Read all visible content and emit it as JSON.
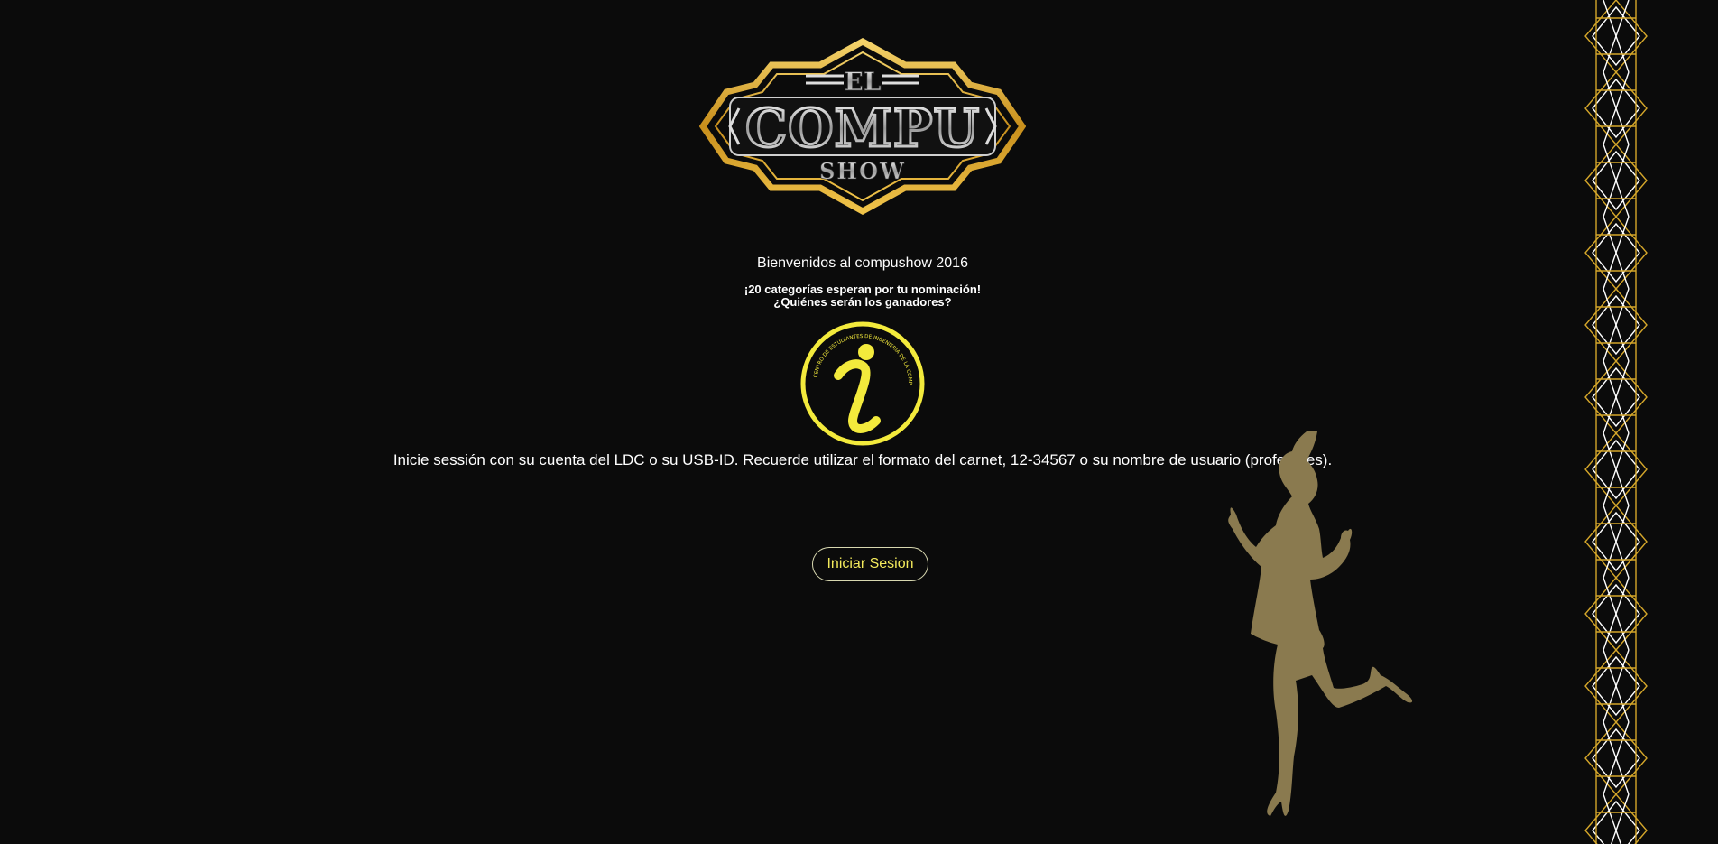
{
  "logo": {
    "line1": "EL",
    "line2": "COMPU",
    "line3": "SHOW"
  },
  "welcome": "Bienvenidos al compushow 2016",
  "tagline": {
    "line1": "¡20 categorías esperan por tu nominación!",
    "line2": "¿Quiénes serán los ganadores?"
  },
  "info_logo": {
    "glyph": "i",
    "ring_text": "CENTRO DE ESTUDIANTES DE INGENIERÍA DE LA COMPUTACIÓN"
  },
  "instructions": "Inicie sessión con su cuenta del LDC o su USB-ID. Recuerde utilizar el formato del carnet, 12-34567 o su nombre de usuario (profesores).",
  "login_button": "Iniciar Sesion",
  "colors": {
    "background": "#0b0b0b",
    "gold": "#d4a62a",
    "accent_yellow": "#f3ea5c",
    "silhouette": "#8a7a4f"
  }
}
